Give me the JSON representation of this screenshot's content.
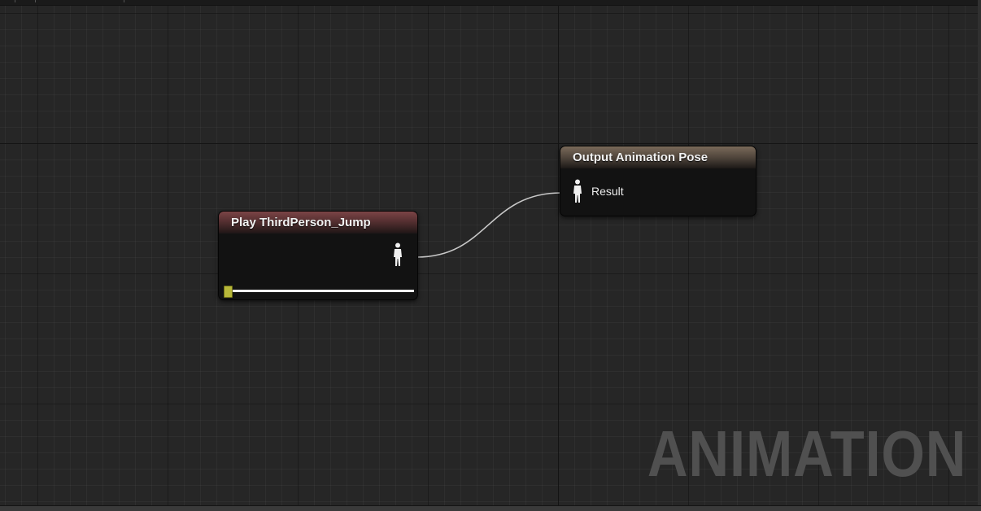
{
  "graph": {
    "watermark": "ANIMATION"
  },
  "nodes": {
    "play": {
      "title": "Play ThirdPerson_Jump",
      "header_color": "#7b4446",
      "output_pin_icon": "pose-person-icon",
      "playback_progress": 0.0,
      "timeline_handle_color": "#b8b83a"
    },
    "output": {
      "title": "Output Animation Pose",
      "header_color": "#7a6a5a",
      "input_pin_icon": "pose-person-icon",
      "input_pin_label": "Result"
    }
  },
  "connections": [
    {
      "from": "play.pose_out",
      "to": "output.result_in",
      "color": "#c8c8c8"
    }
  ]
}
